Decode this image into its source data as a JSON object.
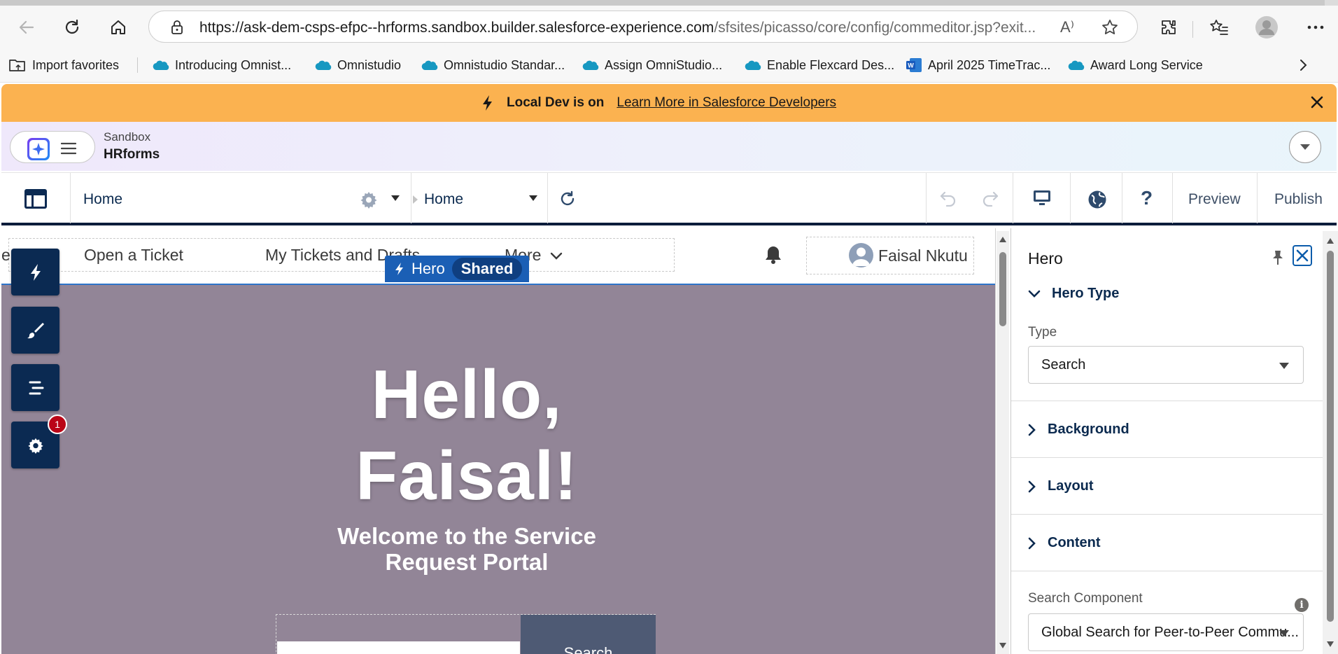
{
  "browser": {
    "url_host": "https://ask-dem-csps-efpc--hrforms.sandbox.builder.salesforce-experience.com",
    "url_path": "/sfsites/picasso/core/config/commeditor.jsp?exit...",
    "read_aloud": "A⁾",
    "bookmarks": [
      {
        "label": "Import favorites",
        "icon": "import-folder-icon"
      },
      {
        "label": "Introducing Omnist...",
        "icon": "salesforce-cloud-icon"
      },
      {
        "label": "Omnistudio",
        "icon": "salesforce-cloud-icon"
      },
      {
        "label": "Omnistudio Standar...",
        "icon": "salesforce-cloud-icon"
      },
      {
        "label": "Assign OmniStudio...",
        "icon": "salesforce-cloud-icon"
      },
      {
        "label": "Enable Flexcard Des...",
        "icon": "salesforce-cloud-icon"
      },
      {
        "label": "April 2025 TimeTrac...",
        "icon": "word-doc-icon"
      },
      {
        "label": "Award Long Service",
        "icon": "salesforce-cloud-icon"
      }
    ]
  },
  "banner": {
    "text": "Local Dev is on",
    "link": "Learn More in Salesforce Developers"
  },
  "app": {
    "env": "Sandbox",
    "name": "HRforms"
  },
  "builder": {
    "page_name": "Home",
    "page_selector": "Home",
    "preview": "Preview",
    "publish": "Publish"
  },
  "site_nav": {
    "partial_item": "e",
    "items": [
      "Open a Ticket",
      "My Tickets and Drafts",
      "More"
    ],
    "user_name": "Faisal Nkutu"
  },
  "hero": {
    "tag_label": "Hero",
    "tag_shared": "Shared",
    "greeting_line1": "Hello,",
    "greeting_line2": "Faisal!",
    "welcome_line1": "Welcome to the Service",
    "welcome_line2": "Request Portal",
    "search_button": "Search"
  },
  "side_tools": {
    "settings_badge": "1"
  },
  "panel": {
    "title": "Hero",
    "section_hero_type": "Hero Type",
    "type_label": "Type",
    "type_value": "Search",
    "section_background": "Background",
    "section_layout": "Layout",
    "section_content": "Content",
    "search_component_label": "Search Component",
    "search_component_value": "Global Search for Peer-to-Peer Commu...",
    "info_glyph": "i"
  },
  "colors": {
    "banner": "#fbb250",
    "hero_bg": "#928597",
    "tool_bg": "#0b2a52",
    "accent": "#1b5fb5"
  }
}
